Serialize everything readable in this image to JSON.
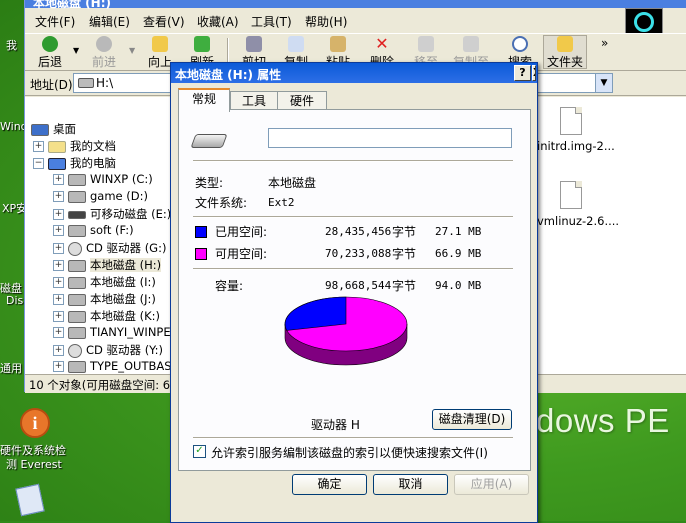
{
  "desktop": {
    "icons": [
      {
        "label": "我"
      },
      {
        "label": "Wind"
      },
      {
        "label": "XP安"
      },
      {
        "label": "磁盘"
      },
      {
        "label": "Dis"
      },
      {
        "label": "通用"
      },
      {
        "label": "硬件及系统检"
      },
      {
        "label": "测 Everest"
      }
    ],
    "watermark": "dows  PE"
  },
  "explorer": {
    "window_title": "本地磁盘 (H:)",
    "menu": [
      "文件(F)",
      "编辑(E)",
      "查看(V)",
      "收藏(A)",
      "工具(T)",
      "帮助(H)"
    ],
    "toolbar": {
      "back": "后退",
      "forward": "前进",
      "up": "向上",
      "refresh": "刷新",
      "cut": "剪切",
      "copy": "复制",
      "paste": "粘贴",
      "delete": "删除",
      "move": "移至",
      "copy_to": "复制至",
      "search": "搜索",
      "folders": "文件夹",
      "more": "»"
    },
    "address": {
      "label": "地址(D)",
      "value": "H:\\"
    },
    "tree": [
      {
        "label": "桌面",
        "icon": "desktop-icon"
      },
      {
        "label": "我的文档",
        "icon": "documents-icon"
      },
      {
        "label": "我的电脑",
        "icon": "computer-icon"
      },
      {
        "label": "WINXP (C:)",
        "icon": "drive-icon"
      },
      {
        "label": "game (D:)",
        "icon": "drive-icon"
      },
      {
        "label": "可移动磁盘 (E:)",
        "icon": "removable-drive-icon"
      },
      {
        "label": "soft (F:)",
        "icon": "drive-icon"
      },
      {
        "label": "CD 驱动器 (G:)",
        "icon": "cd-drive-icon"
      },
      {
        "label": "本地磁盘 (H:)",
        "icon": "drive-icon"
      },
      {
        "label": "本地磁盘 (I:)",
        "icon": "drive-icon"
      },
      {
        "label": "本地磁盘 (J:)",
        "icon": "drive-icon"
      },
      {
        "label": "本地磁盘 (K:)",
        "icon": "drive-icon"
      },
      {
        "label": "TIANYI_WINPE (",
        "icon": "drive-icon"
      },
      {
        "label": "CD 驱动器 (Y:)",
        "icon": "cd-drive-icon"
      },
      {
        "label": "TYPE_OUTBASE (",
        "icon": "drive-icon"
      }
    ],
    "files": [
      {
        "name": "initrd.img-2..."
      },
      {
        "name": "vmlinuz-2.6...."
      }
    ],
    "status": "10 个对象(可用磁盘空间: 66"
  },
  "dialog": {
    "title": "本地磁盘 (H:) 属性",
    "help_btn": "?",
    "close_btn": "X",
    "tabs": [
      "常规",
      "工具",
      "硬件"
    ],
    "name_value": "",
    "type_label": "类型:",
    "type_value": "本地磁盘",
    "fs_label": "文件系统:",
    "fs_value": "Ext2",
    "used": {
      "label": "已用空间:",
      "bytes": "28,435,456",
      "unit": "字节",
      "size": "27.1 MB",
      "color": "#0000ff"
    },
    "free": {
      "label": "可用空间:",
      "bytes": "70,233,088",
      "unit": "字节",
      "size": "66.9 MB",
      "color": "#ff00ff"
    },
    "capacity": {
      "label": "容量:",
      "bytes": "98,668,544",
      "unit": "字节",
      "size": "94.0 MB"
    },
    "drive_label": "驱动器 H",
    "cleanup_btn": "磁盘清理(D)",
    "index_checkbox": "允许索引服务编制该磁盘的索引以便快速搜索文件(I)",
    "index_checked": true,
    "ok": "确定",
    "cancel": "取消",
    "apply": "应用(A)"
  }
}
